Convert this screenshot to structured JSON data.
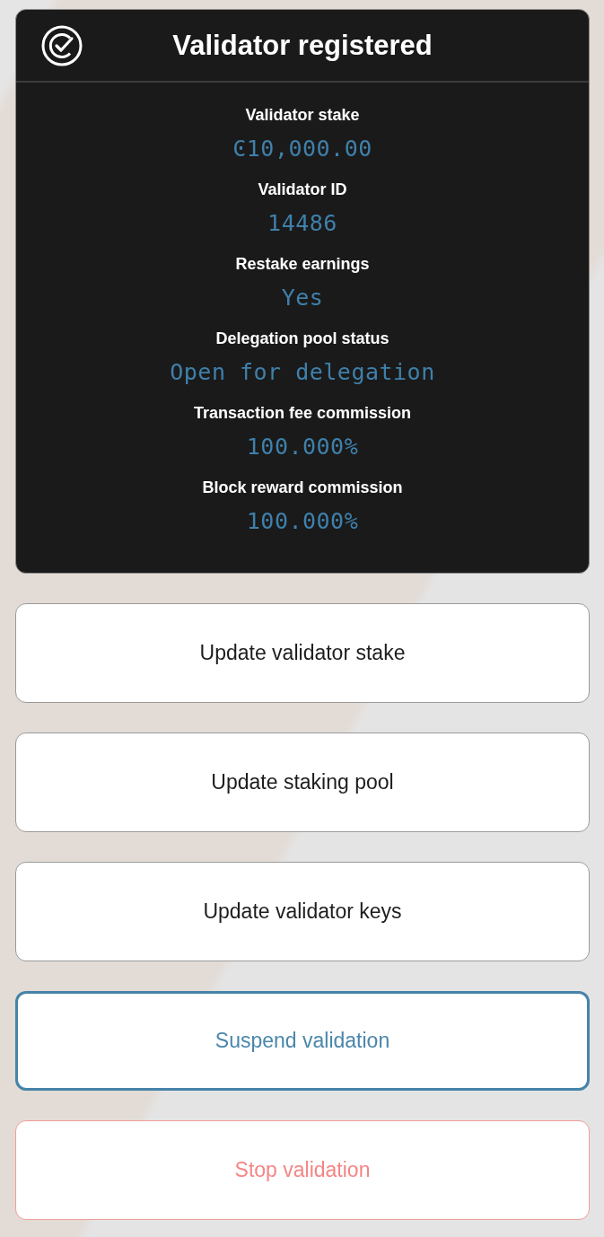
{
  "header": {
    "title": "Validator registered"
  },
  "details": [
    {
      "label": "Validator stake",
      "value": "Ͼ10,000.00"
    },
    {
      "label": "Validator ID",
      "value": "14486"
    },
    {
      "label": "Restake earnings",
      "value": "Yes"
    },
    {
      "label": "Delegation pool status",
      "value": "Open for delegation"
    },
    {
      "label": "Transaction fee commission",
      "value": "100.000%"
    },
    {
      "label": "Block reward commission",
      "value": "100.000%"
    }
  ],
  "actions": [
    {
      "label": "Update validator stake",
      "kind": "default"
    },
    {
      "label": "Update staking pool",
      "kind": "default"
    },
    {
      "label": "Update validator keys",
      "kind": "default"
    },
    {
      "label": "Suspend validation",
      "kind": "primary"
    },
    {
      "label": "Stop validation",
      "kind": "danger"
    }
  ]
}
